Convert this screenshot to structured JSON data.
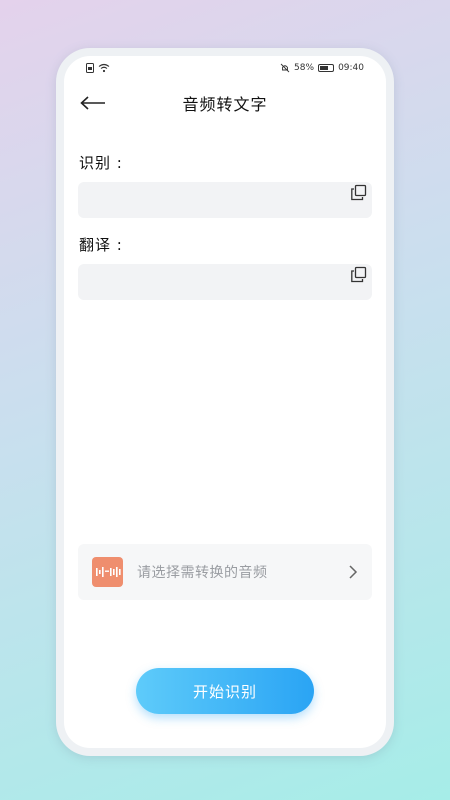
{
  "status_bar": {
    "battery": "58%",
    "time": "09:40"
  },
  "header": {
    "title": "音频转文字"
  },
  "recognition": {
    "label": "识别 :",
    "value": ""
  },
  "translation": {
    "label": "翻译 :",
    "value": ""
  },
  "audio_select": {
    "placeholder": "请选择需转换的音频"
  },
  "actions": {
    "start_label": "开始识别"
  },
  "colors": {
    "primary_start": "#5ecbfa",
    "primary_end": "#2aa4f4",
    "audio_icon": "#ef8e6e",
    "field_bg": "#f2f3f5"
  }
}
